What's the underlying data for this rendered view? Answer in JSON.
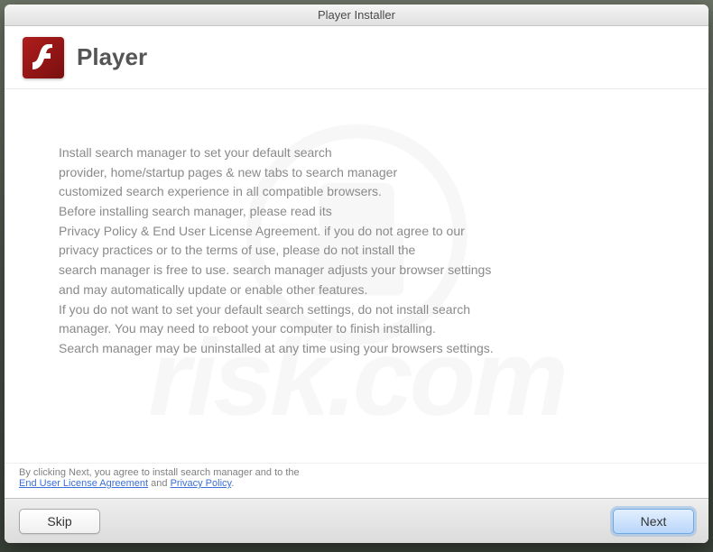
{
  "titlebar": {
    "title": "Player Installer"
  },
  "header": {
    "app_name": "Player"
  },
  "body_text": "Install search manager to set your default search\nprovider, home/startup pages & new tabs to search manager\ncustomized search experience in all compatible browsers.\nBefore installing search manager, please read its\nPrivacy Policy & End User License Agreement. if you do not agree to our\nprivacy practices or to the terms of use, please do not install the\nsearch manager is free to use. search manager adjusts your browser settings\nand may automatically update or enable other features.\nIf you do not want to set your default search settings, do not install search\nmanager. You may need to reboot your computer to finish installing.\nSearch manager may be uninstalled at any time using your browsers settings.",
  "disclaimer": {
    "line1": "By clicking Next, you agree to install search manager and to the",
    "eula": "End User License Agreement",
    "and": " and ",
    "privacy": "Privacy Policy",
    "dot": "."
  },
  "buttons": {
    "skip": "Skip",
    "next": "Next"
  },
  "watermark": {
    "text": "risk.com"
  }
}
